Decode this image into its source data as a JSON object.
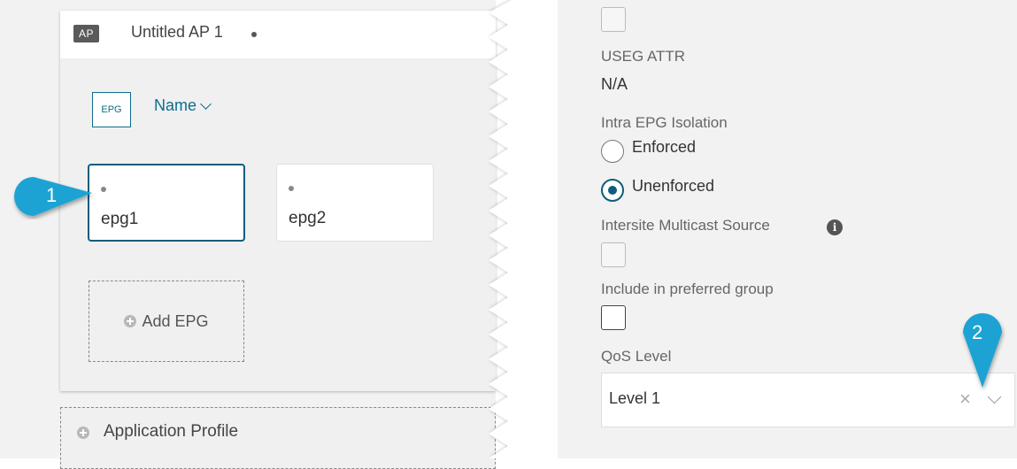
{
  "ap_card": {
    "badge": "AP",
    "title": "Untitled AP 1",
    "epg_icon_label": "EPG",
    "sort_label": "Name",
    "epgs": [
      {
        "label": "epg1",
        "selected": true
      },
      {
        "label": "epg2",
        "selected": false
      }
    ],
    "add_epg_label": "Add EPG"
  },
  "application_profile_label": "Application Profile",
  "properties": {
    "useg_attr_label": "USEG ATTR",
    "useg_attr_value": "N/A",
    "intra_epg_label": "Intra EPG Isolation",
    "intra_epg_options": [
      {
        "label": "Enforced",
        "checked": false
      },
      {
        "label": "Unenforced",
        "checked": true
      }
    ],
    "intersite_label": "Intersite Multicast Source",
    "preferred_group_label": "Include in preferred group",
    "qos_label": "QoS Level",
    "qos_value": "Level 1"
  },
  "callouts": [
    "1",
    "2"
  ],
  "colors": {
    "accent": "#0d5e7c",
    "callout": "#1ba3d4",
    "badge": "#5a5a5a"
  }
}
